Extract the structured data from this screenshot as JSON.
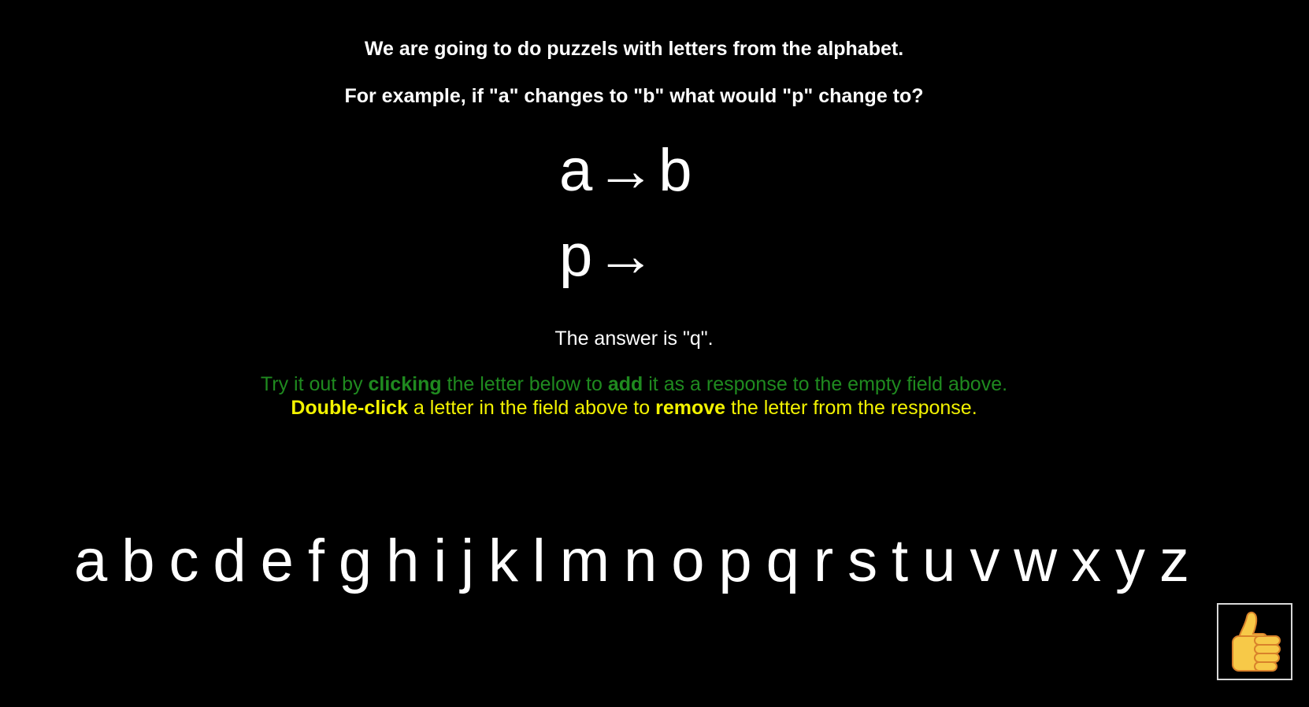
{
  "intro": {
    "line1": "We are going to do puzzels with letters from the alphabet.",
    "line2": "For example, if \"a\" changes to \"b\" what would \"p\" change to?"
  },
  "puzzle": {
    "example_source": "a",
    "example_target": "b",
    "arrow": "→",
    "query_source": "p",
    "response": ""
  },
  "answer_text": "The answer is \"q\".",
  "hints": {
    "green": {
      "p1": "Try it out by ",
      "b1": "clicking",
      "p2": " the letter below to ",
      "b2": "add",
      "p3": " it as a response to the empty field above."
    },
    "yellow": {
      "b1": "Double-click",
      "p1": " a letter in the field above to ",
      "b2": "remove",
      "p2": " the letter from the response."
    }
  },
  "alphabet": [
    "a",
    "b",
    "c",
    "d",
    "e",
    "f",
    "g",
    "h",
    "i",
    "j",
    "k",
    "l",
    "m",
    "n",
    "o",
    "p",
    "q",
    "r",
    "s",
    "t",
    "u",
    "v",
    "w",
    "x",
    "y",
    "z"
  ],
  "done_button": {
    "icon": "thumbs-up-icon"
  },
  "colors": {
    "background": "#000000",
    "text": "#ffffff",
    "hint_green": "#1f8a1f",
    "hint_yellow": "#f2f200",
    "button_border": "#d8d8d8"
  }
}
